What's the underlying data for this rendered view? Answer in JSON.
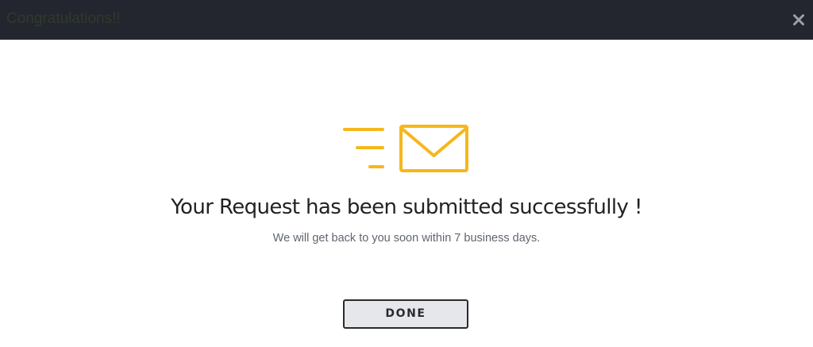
{
  "dialog": {
    "title": "Congratulations!!",
    "close_icon": "close-icon"
  },
  "illustration": {
    "icon": "envelope-sent-icon",
    "accent_color": "#f5b71b"
  },
  "message": {
    "headline": "Your Request has been submitted successfully !",
    "subtext": "We will get back to you soon within 7 business days."
  },
  "actions": {
    "done_label": "DONE"
  },
  "colors": {
    "header_bg": "#23262f",
    "button_bg": "#e5e7eb",
    "button_border": "#2b2b2b"
  }
}
